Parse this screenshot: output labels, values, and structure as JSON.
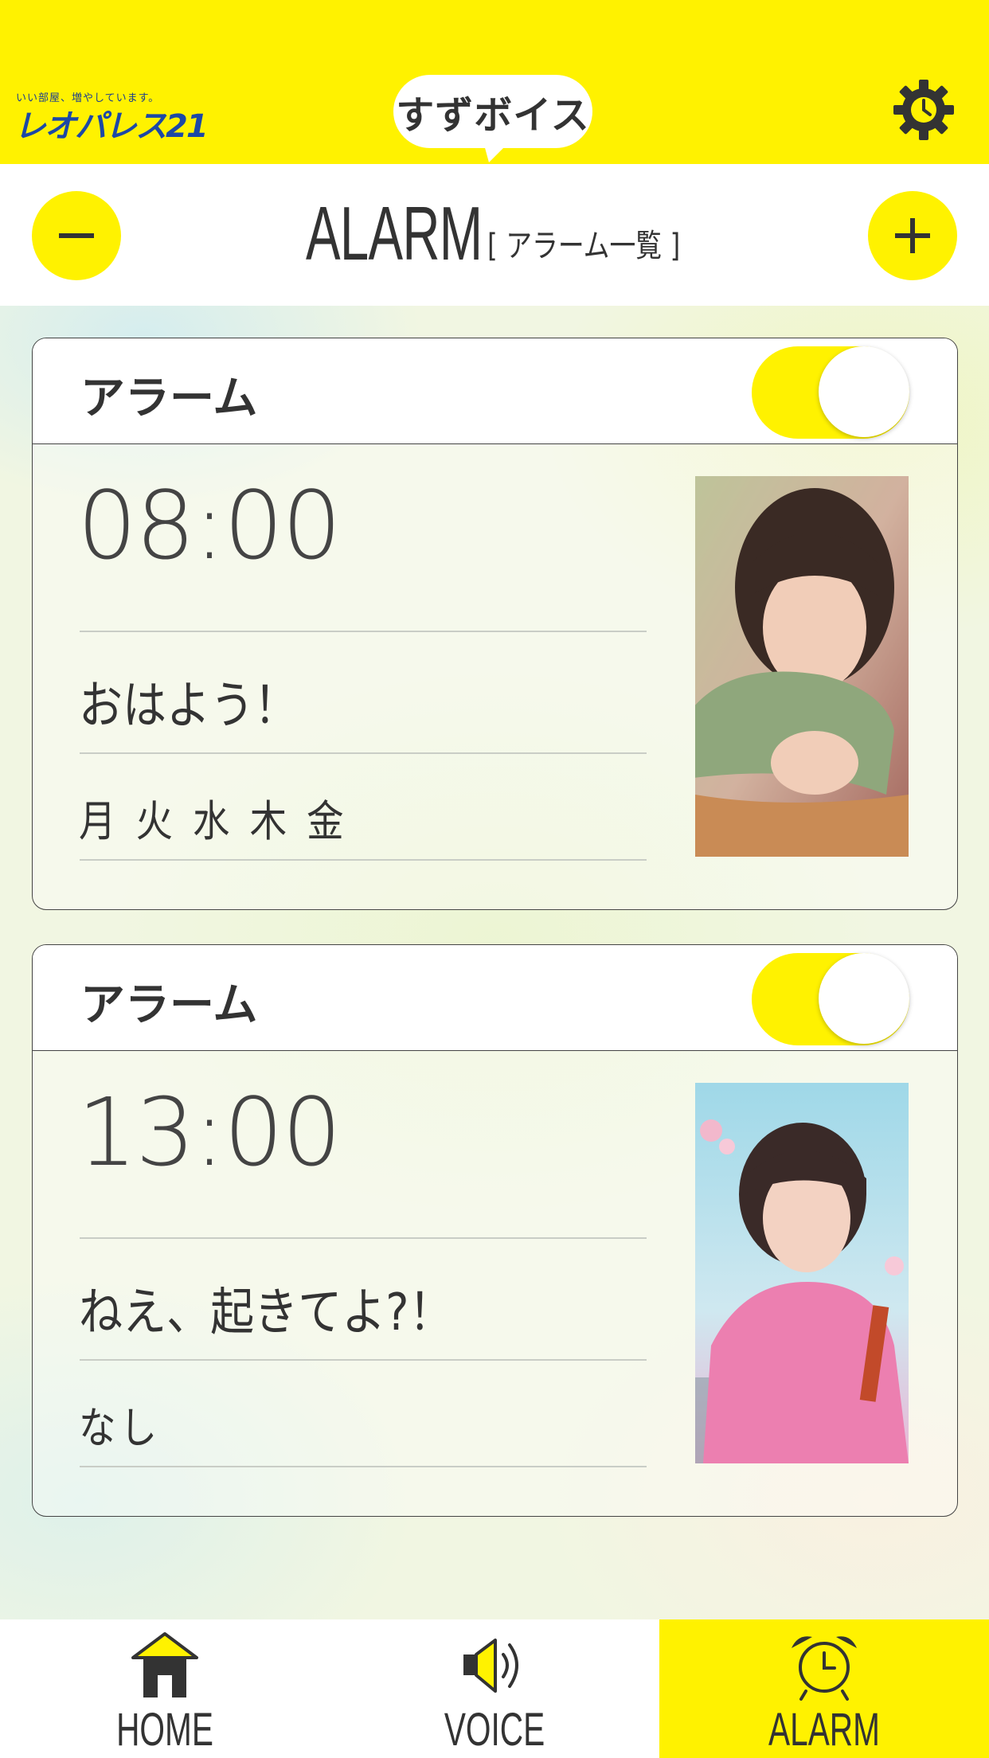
{
  "header": {
    "logo_tagline": "いい部屋、増やしています。",
    "logo_wordmark": "レオパレス",
    "logo_wordmark_number": "21",
    "brand_name": "すずボイス",
    "settings_icon": "gear-icon"
  },
  "titlebar": {
    "title": "ALARM",
    "subtitle": "[ アラーム一覧 ]",
    "remove_icon": "minus-icon",
    "add_icon": "plus-icon"
  },
  "alarms": [
    {
      "label": "アラーム",
      "enabled": true,
      "time": "08:00",
      "message": "おはよう！",
      "days": "月 火 水 木 金"
    },
    {
      "label": "アラーム",
      "enabled": true,
      "time": "13:00",
      "message": "ねえ、起きてよ?！",
      "days": "なし"
    }
  ],
  "nav": {
    "items": [
      {
        "label": "HOME",
        "icon": "home-icon",
        "active": false
      },
      {
        "label": "VOICE",
        "icon": "speaker-icon",
        "active": false
      },
      {
        "label": "ALARM",
        "icon": "alarm-clock-icon",
        "active": true
      }
    ]
  },
  "colors": {
    "accent": "#FFF200",
    "text": "#333333",
    "brand_blue": "#1c48a6"
  }
}
